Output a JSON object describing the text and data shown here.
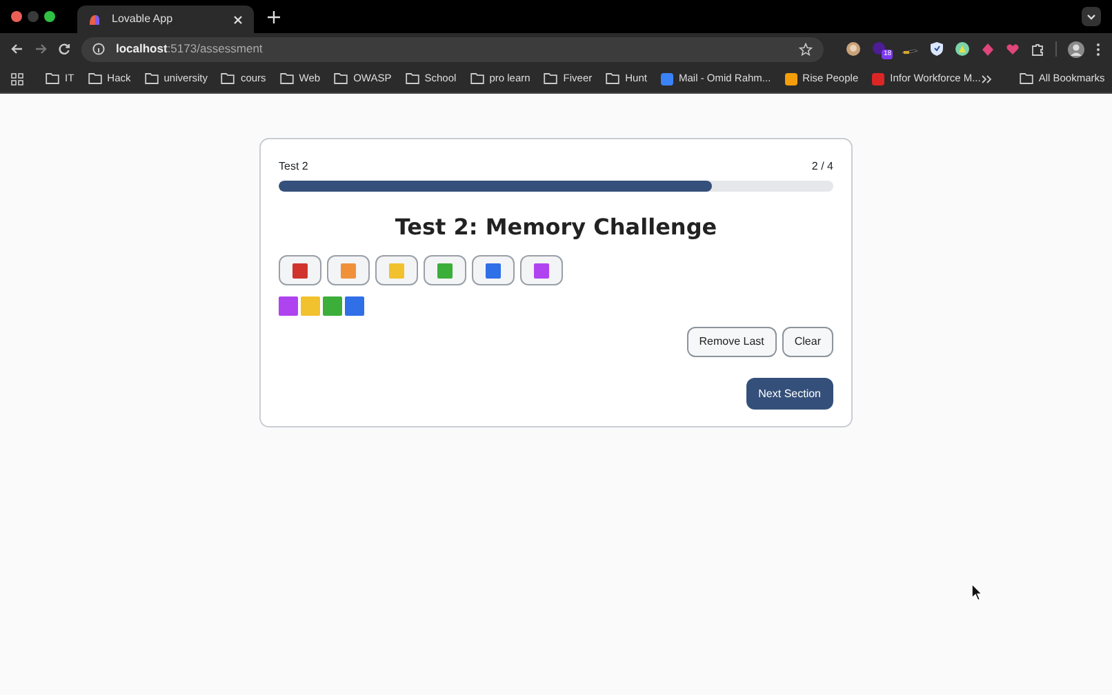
{
  "browser": {
    "tab": {
      "title": "Lovable App"
    },
    "url": {
      "host": "localhost",
      "path": ":5173/assessment"
    },
    "bookmarks": [
      {
        "kind": "folder",
        "label": "IT"
      },
      {
        "kind": "folder",
        "label": "Hack"
      },
      {
        "kind": "folder",
        "label": "university"
      },
      {
        "kind": "folder",
        "label": "cours"
      },
      {
        "kind": "folder",
        "label": "Web"
      },
      {
        "kind": "folder",
        "label": "OWASP"
      },
      {
        "kind": "folder",
        "label": "School"
      },
      {
        "kind": "folder",
        "label": "pro learn"
      },
      {
        "kind": "folder",
        "label": "Fiveer"
      },
      {
        "kind": "folder",
        "label": "Hunt"
      },
      {
        "kind": "site",
        "label": "Mail - Omid Rahm...",
        "color": "#3b82f6"
      },
      {
        "kind": "site",
        "label": "Rise People",
        "color": "#f59e0b"
      },
      {
        "kind": "site",
        "label": "Infor Workforce M...",
        "color": "#dc2626"
      }
    ],
    "all_bookmarks": "All Bookmarks",
    "extension_badge": "18"
  },
  "assessment": {
    "section": "Test 2",
    "count": "2 / 4",
    "progress": {
      "level": 0.78
    },
    "title": "Test 2: Memory Challenge",
    "palette": [
      {
        "color": "#d0342c"
      },
      {
        "color": "#f0913a"
      },
      {
        "color": "#f2c12e"
      },
      {
        "color": "#3cae3a"
      },
      {
        "color": "#2f6fe8"
      },
      {
        "color": "#b043f0"
      }
    ],
    "sequence": [
      {
        "color": "#b043f0"
      },
      {
        "color": "#f2c12e"
      },
      {
        "color": "#3cae3a"
      },
      {
        "color": "#2f6fe8"
      }
    ],
    "actions": [
      "Remove Last",
      "Clear"
    ],
    "next": "Next Section"
  }
}
